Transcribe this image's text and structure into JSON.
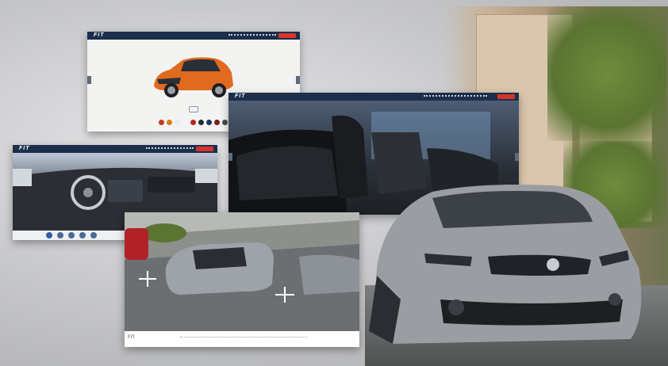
{
  "window_title": "",
  "cards": {
    "color_picker": {
      "logo": "FIT",
      "swatch_colors": [
        "#c23a22",
        "#d87c1c",
        "#e9e9e9",
        "#f4f4f4",
        "#b3261e",
        "#2b2b2b",
        "#1c3760",
        "#7e1d1d",
        "#4a4a4a"
      ],
      "cta_color": "#d7342b"
    },
    "interior_view": {
      "logo": "FIT"
    },
    "dashboard_view": {
      "logo": "FIT",
      "tray_icon_count": 5
    },
    "parking_view": {
      "brand": "FIT"
    }
  },
  "colors": {
    "nav_bar": "#1c2f4a",
    "cta": "#d7342b",
    "orange_car": "#e06a1e",
    "silver_car": "#9a9ea3"
  }
}
